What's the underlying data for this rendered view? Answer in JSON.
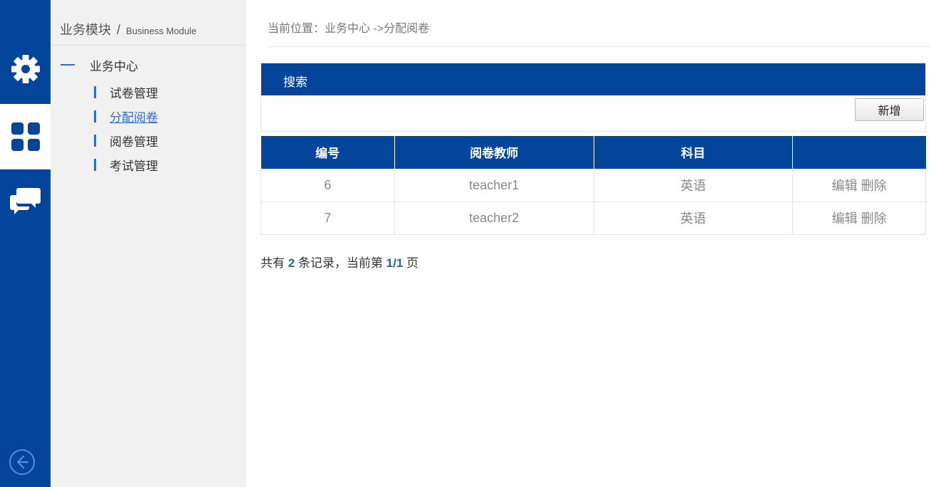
{
  "rail": {
    "items": [
      {
        "icon": "gear-icon"
      },
      {
        "icon": "grid-icon"
      },
      {
        "icon": "chat-icon"
      }
    ],
    "back_icon": "back-arrow-icon"
  },
  "subnav": {
    "title": "业务模块",
    "separator": "/",
    "title_en": "Business Module",
    "group_label": "业务中心",
    "items": [
      {
        "label": "试卷管理"
      },
      {
        "label": "分配阅卷"
      },
      {
        "label": "阅卷管理"
      },
      {
        "label": "考试管理"
      }
    ]
  },
  "breadcrumb": "当前位置：业务中心 ->分配阅卷",
  "search": {
    "title": "搜索",
    "add_label": "新增"
  },
  "table": {
    "headers": [
      "编号",
      "阅卷教师",
      "科目",
      ""
    ],
    "rows": [
      {
        "id": "6",
        "teacher": "teacher1",
        "subject": "英语",
        "edit": "编辑",
        "delete": "删除"
      },
      {
        "id": "7",
        "teacher": "teacher2",
        "subject": "英语",
        "edit": "编辑",
        "delete": "删除"
      }
    ]
  },
  "summary": {
    "prefix": "共有",
    "count": "2",
    "middle": "条记录，当前第",
    "page": "1/1",
    "suffix": "页"
  },
  "colors": {
    "brand": "#03459a",
    "link": "#2f6bd1"
  }
}
